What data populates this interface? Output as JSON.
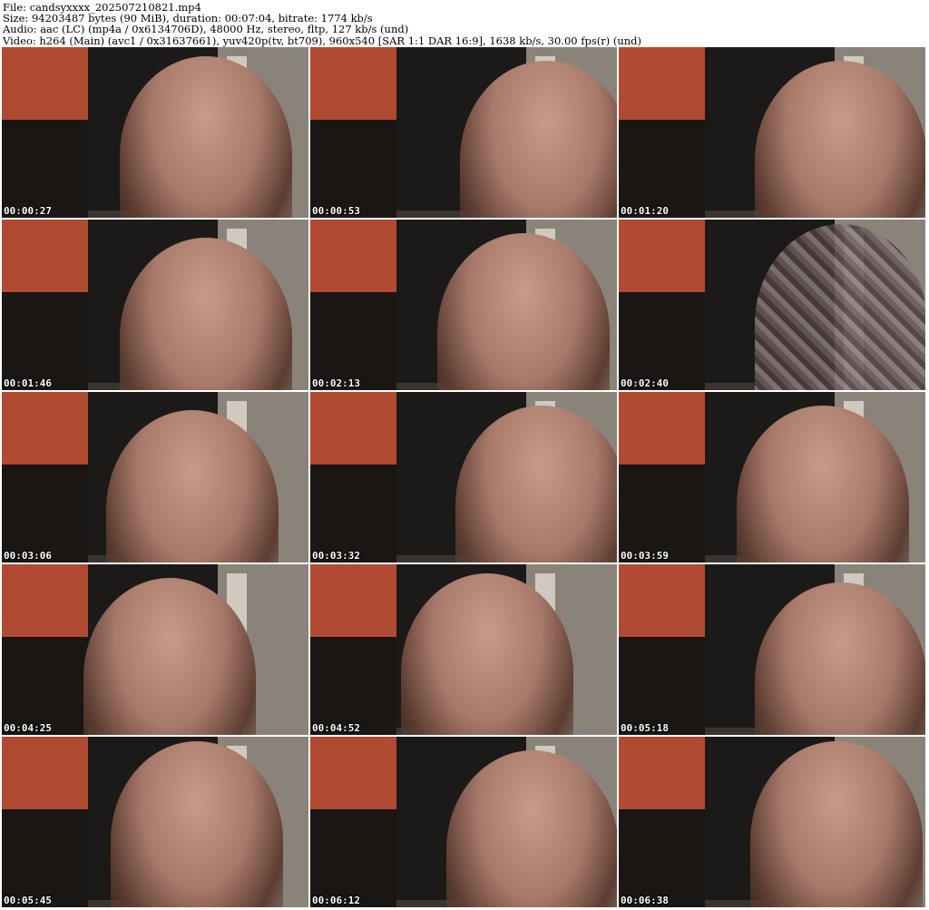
{
  "header": {
    "file_line": "File: candsyxxxx_202507210821.mp4",
    "size_line": "Size: 94203487 bytes (90 MiB), duration: 00:07:04, bitrate: 1774 kb/s",
    "audio_line": "Audio: aac (LC) (mp4a / 0x6134706D), 48000 Hz, stereo, fltp, 127 kb/s (und)",
    "video_line": "Video: h264 (Main) (avc1 / 0x31637661), yuv420p(tv, bt709), 960x540 [SAR 1:1 DAR 16:9], 1638 kb/s, 30.00 fps(r) (und)"
  },
  "thumbnails": [
    {
      "timestamp": "00:00:27"
    },
    {
      "timestamp": "00:00:53"
    },
    {
      "timestamp": "00:01:20"
    },
    {
      "timestamp": "00:01:46"
    },
    {
      "timestamp": "00:02:13"
    },
    {
      "timestamp": "00:02:40"
    },
    {
      "timestamp": "00:03:06"
    },
    {
      "timestamp": "00:03:32"
    },
    {
      "timestamp": "00:03:59"
    },
    {
      "timestamp": "00:04:25"
    },
    {
      "timestamp": "00:04:52"
    },
    {
      "timestamp": "00:05:18"
    },
    {
      "timestamp": "00:05:45"
    },
    {
      "timestamp": "00:06:12"
    },
    {
      "timestamp": "00:06:38"
    }
  ]
}
